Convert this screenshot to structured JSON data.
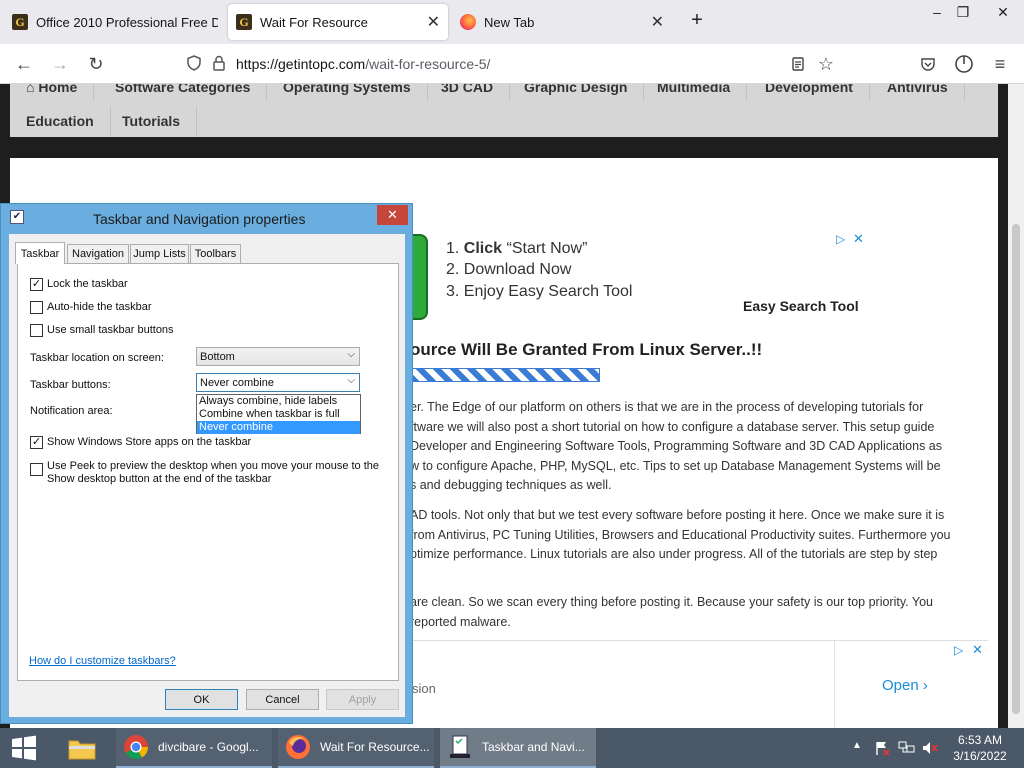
{
  "browser": {
    "tabs": [
      {
        "title": "Office 2010 Professional Free Do",
        "active": false
      },
      {
        "title": "Wait For Resource",
        "active": true
      },
      {
        "title": "New Tab",
        "active": false
      }
    ],
    "url_host": "https://getintopc.com",
    "url_path": "/wait-for-resource-5/"
  },
  "site": {
    "nav": [
      "Home",
      "Software Categories",
      "Operating Systems",
      "3D CAD",
      "Graphic Design",
      "Multimedia",
      "Development",
      "Antivirus",
      "Education",
      "Tutorials"
    ],
    "ad_top": {
      "step1_num": "1.",
      "step1_bold": "Click",
      "step1_rest": "“Start Now”",
      "step2": "2. Download Now",
      "step3": "3. Enjoy Easy Search Tool",
      "brand": "Easy Search Tool"
    },
    "heading": "ource Will Be Granted From Linux Server..!!",
    "paragraphs": [
      [
        "er. The Edge of our platform on others is that we are in the process of developing tutorials for",
        "ftware we will also post a short tutorial on how to configure a database server. This setup guide",
        "Developer and Engineering Software Tools, Programming Software and 3D CAD Applications as",
        "w to configure Apache, PHP, MySQL, etc. Tips to set up Database Management Systems will be",
        "s and debugging techniques as well."
      ],
      [
        "AD tools. Not only that but we test every software before posting it here. Once we make sure it is",
        "from Antivirus, PC Tuning Utilities, Browsers and Educational Productivity suites. Furthermore you",
        "ptimize performance. Linux tutorials are also under progress. All of the tutorials are step by step"
      ],
      [
        "are clean. So we scan every thing before posting it. Because your safety is our top priority. You",
        "reported malware."
      ]
    ],
    "bottom_ad": {
      "left_text": "sion",
      "cta": "Open"
    }
  },
  "dialog": {
    "title": "Taskbar and Navigation properties",
    "tabs": [
      "Taskbar",
      "Navigation",
      "Jump Lists",
      "Toolbars"
    ],
    "checkboxes": {
      "lock": {
        "label": "Lock the taskbar",
        "checked": true
      },
      "autohide": {
        "label": "Auto-hide the taskbar",
        "checked": false
      },
      "small": {
        "label": "Use small taskbar buttons",
        "checked": false
      },
      "store": {
        "label": "Show Windows Store apps on the taskbar",
        "checked": true
      },
      "peek": {
        "label_line1": "Use Peek to preview the desktop when you move your mouse to the",
        "label_line2": "Show desktop button at the end of the taskbar",
        "checked": false
      }
    },
    "location_label": "Taskbar location on screen:",
    "location_value": "Bottom",
    "buttons_label": "Taskbar buttons:",
    "buttons_value": "Never combine",
    "buttons_options": [
      "Always combine, hide labels",
      "Combine when taskbar is full",
      "Never combine"
    ],
    "notification_label": "Notification area:",
    "help_link": "How do I customize taskbars?",
    "ok": "OK",
    "cancel": "Cancel",
    "apply": "Apply"
  },
  "taskbar": {
    "apps": [
      {
        "label": "divcibare - Googl...",
        "icon": "chrome-icon"
      },
      {
        "label": "Wait For Resource...",
        "icon": "firefox-icon"
      },
      {
        "label": "Taskbar and Navi...",
        "icon": "taskbar-properties-icon"
      }
    ],
    "time": "6:53 AM",
    "date": "3/16/2022"
  }
}
